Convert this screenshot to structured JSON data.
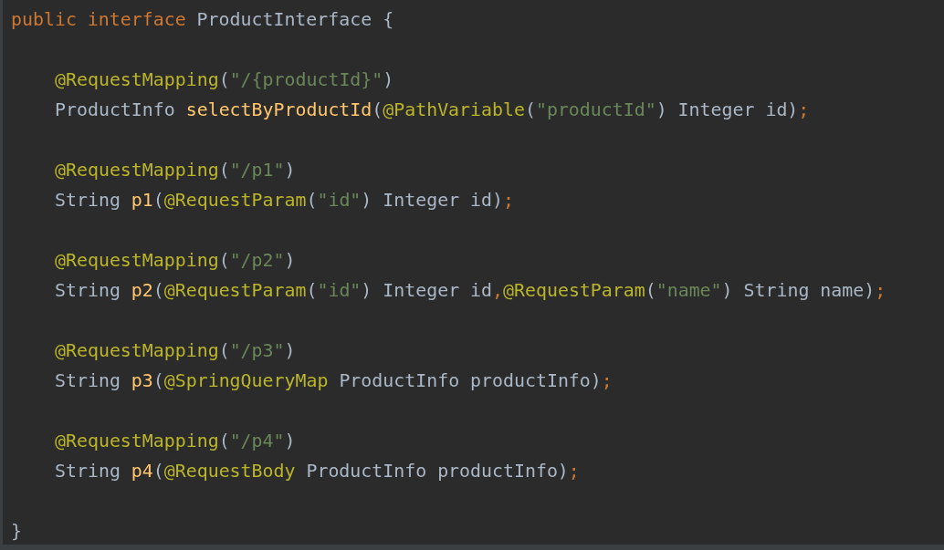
{
  "editor": {
    "header": [
      {
        "kind": "keyword",
        "text": "public interface "
      },
      {
        "kind": "plain",
        "text": "ProductInterface {"
      }
    ],
    "body": [
      {
        "kind": "blank"
      },
      {
        "kind": "code",
        "tokens": [
          {
            "kind": "annotation",
            "text": "@RequestMapping"
          },
          {
            "kind": "plain",
            "text": "("
          },
          {
            "kind": "string",
            "text": "\"/{productId}\""
          },
          {
            "kind": "plain",
            "text": ")"
          }
        ]
      },
      {
        "kind": "code",
        "tokens": [
          {
            "kind": "plain",
            "text": "ProductInfo "
          },
          {
            "kind": "method",
            "text": "selectByProductId"
          },
          {
            "kind": "plain",
            "text": "("
          },
          {
            "kind": "annotation",
            "text": "@PathVariable"
          },
          {
            "kind": "plain",
            "text": "("
          },
          {
            "kind": "string",
            "text": "\"productId\""
          },
          {
            "kind": "plain",
            "text": ") Integer id)"
          },
          {
            "kind": "keyword",
            "text": ";"
          }
        ]
      },
      {
        "kind": "blank"
      },
      {
        "kind": "code",
        "tokens": [
          {
            "kind": "annotation",
            "text": "@RequestMapping"
          },
          {
            "kind": "plain",
            "text": "("
          },
          {
            "kind": "string",
            "text": "\"/p1\""
          },
          {
            "kind": "plain",
            "text": ")"
          }
        ]
      },
      {
        "kind": "code",
        "tokens": [
          {
            "kind": "plain",
            "text": "String "
          },
          {
            "kind": "method",
            "text": "p1"
          },
          {
            "kind": "plain",
            "text": "("
          },
          {
            "kind": "annotation",
            "text": "@RequestParam"
          },
          {
            "kind": "plain",
            "text": "("
          },
          {
            "kind": "string",
            "text": "\"id\""
          },
          {
            "kind": "plain",
            "text": ") Integer id)"
          },
          {
            "kind": "keyword",
            "text": ";"
          }
        ]
      },
      {
        "kind": "blank"
      },
      {
        "kind": "code",
        "tokens": [
          {
            "kind": "annotation",
            "text": "@RequestMapping"
          },
          {
            "kind": "plain",
            "text": "("
          },
          {
            "kind": "string",
            "text": "\"/p2\""
          },
          {
            "kind": "plain",
            "text": ")"
          }
        ]
      },
      {
        "kind": "code",
        "tokens": [
          {
            "kind": "plain",
            "text": "String "
          },
          {
            "kind": "method",
            "text": "p2"
          },
          {
            "kind": "plain",
            "text": "("
          },
          {
            "kind": "annotation",
            "text": "@RequestParam"
          },
          {
            "kind": "plain",
            "text": "("
          },
          {
            "kind": "string",
            "text": "\"id\""
          },
          {
            "kind": "plain",
            "text": ") Integer id"
          },
          {
            "kind": "keyword",
            "text": ","
          },
          {
            "kind": "annotation",
            "text": "@RequestParam"
          },
          {
            "kind": "plain",
            "text": "("
          },
          {
            "kind": "string",
            "text": "\"name\""
          },
          {
            "kind": "plain",
            "text": ") String name)"
          },
          {
            "kind": "keyword",
            "text": ";"
          }
        ]
      },
      {
        "kind": "blank"
      },
      {
        "kind": "code",
        "tokens": [
          {
            "kind": "annotation",
            "text": "@RequestMapping"
          },
          {
            "kind": "plain",
            "text": "("
          },
          {
            "kind": "string",
            "text": "\"/p3\""
          },
          {
            "kind": "plain",
            "text": ")"
          }
        ]
      },
      {
        "kind": "code",
        "tokens": [
          {
            "kind": "plain",
            "text": "String "
          },
          {
            "kind": "method",
            "text": "p3"
          },
          {
            "kind": "plain",
            "text": "("
          },
          {
            "kind": "annotation",
            "text": "@SpringQueryMap"
          },
          {
            "kind": "plain",
            "text": " ProductInfo productInfo)"
          },
          {
            "kind": "keyword",
            "text": ";"
          }
        ]
      },
      {
        "kind": "blank"
      },
      {
        "kind": "code",
        "tokens": [
          {
            "kind": "annotation",
            "text": "@RequestMapping"
          },
          {
            "kind": "plain",
            "text": "("
          },
          {
            "kind": "string",
            "text": "\"/p4\""
          },
          {
            "kind": "plain",
            "text": ")"
          }
        ]
      },
      {
        "kind": "code",
        "tokens": [
          {
            "kind": "plain",
            "text": "String "
          },
          {
            "kind": "method",
            "text": "p4"
          },
          {
            "kind": "plain",
            "text": "("
          },
          {
            "kind": "annotation",
            "text": "@RequestBody"
          },
          {
            "kind": "plain",
            "text": " ProductInfo productInfo)"
          },
          {
            "kind": "keyword",
            "text": ";"
          }
        ]
      },
      {
        "kind": "blank"
      }
    ],
    "closing": [
      {
        "kind": "plain",
        "text": "}"
      }
    ]
  }
}
